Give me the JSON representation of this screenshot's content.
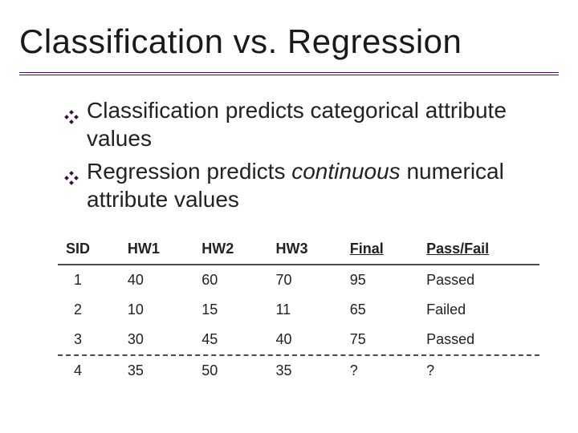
{
  "title": "Classification vs. Regression",
  "bullets": {
    "b1": "Classification predicts categorical attribute values",
    "b2_pre": "Regression predicts ",
    "b2_em": "continuous",
    "b2_post": " numerical attribute values"
  },
  "table": {
    "headers": {
      "c1": "SID",
      "c2": "HW1",
      "c3": "HW2",
      "c4": "HW3",
      "c5": "Final",
      "c6": "Pass/Fail"
    },
    "rows": [
      {
        "c1": "1",
        "c2": "40",
        "c3": "60",
        "c4": "70",
        "c5": "95",
        "c6": "Passed"
      },
      {
        "c1": "2",
        "c2": "10",
        "c3": "15",
        "c4": "11",
        "c5": "65",
        "c6": "Failed"
      },
      {
        "c1": "3",
        "c2": "30",
        "c3": "45",
        "c4": "40",
        "c5": "75",
        "c6": "Passed"
      },
      {
        "c1": "4",
        "c2": "35",
        "c3": "50",
        "c4": "35",
        "c5": "?",
        "c6": "?"
      }
    ]
  },
  "chart_data": {
    "type": "table",
    "title": "Classification vs. Regression — student scores",
    "columns": [
      "SID",
      "HW1",
      "HW2",
      "HW3",
      "Final",
      "Pass/Fail"
    ],
    "rows": [
      [
        1,
        40,
        60,
        70,
        95,
        "Passed"
      ],
      [
        2,
        10,
        15,
        11,
        65,
        "Failed"
      ],
      [
        3,
        30,
        45,
        40,
        75,
        "Passed"
      ],
      [
        4,
        35,
        50,
        35,
        "?",
        "?"
      ]
    ]
  }
}
